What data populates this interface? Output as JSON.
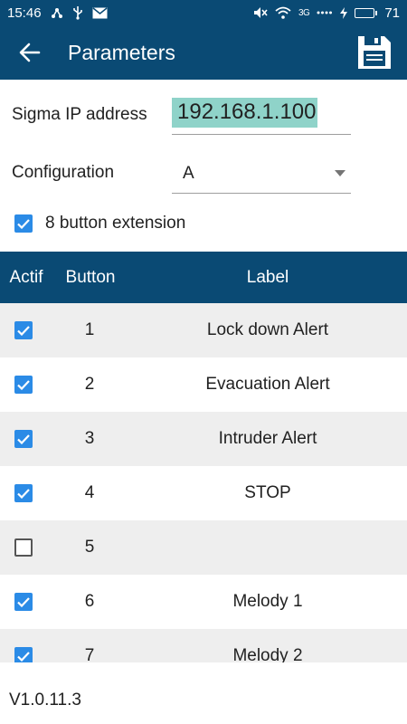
{
  "status_bar": {
    "time": "15:46",
    "network": "3G",
    "battery": "71",
    "battery_level": 0.71
  },
  "app_bar": {
    "title": "Parameters"
  },
  "form": {
    "ip_label": "Sigma IP address",
    "ip_value": "192.168.1.100",
    "configuration_label": "Configuration",
    "configuration_value": "A",
    "extension_label": "8 button extension",
    "extension_checked": true
  },
  "table": {
    "headers": {
      "actif": "Actif",
      "button": "Button",
      "label": "Label"
    },
    "rows": [
      {
        "actif": true,
        "button": "1",
        "label": "Lock down Alert"
      },
      {
        "actif": true,
        "button": "2",
        "label": "Evacuation Alert"
      },
      {
        "actif": true,
        "button": "3",
        "label": "Intruder Alert"
      },
      {
        "actif": true,
        "button": "4",
        "label": "STOP"
      },
      {
        "actif": false,
        "button": "5",
        "label": ""
      },
      {
        "actif": true,
        "button": "6",
        "label": "Melody 1"
      },
      {
        "actif": true,
        "button": "7",
        "label": "Melody 2"
      }
    ]
  },
  "footer": {
    "version": "V1.0.11.3"
  },
  "colors": {
    "primary": "#0a4a74",
    "checkbox": "#2b8be6",
    "ip_highlight": "#8fd3c9"
  }
}
